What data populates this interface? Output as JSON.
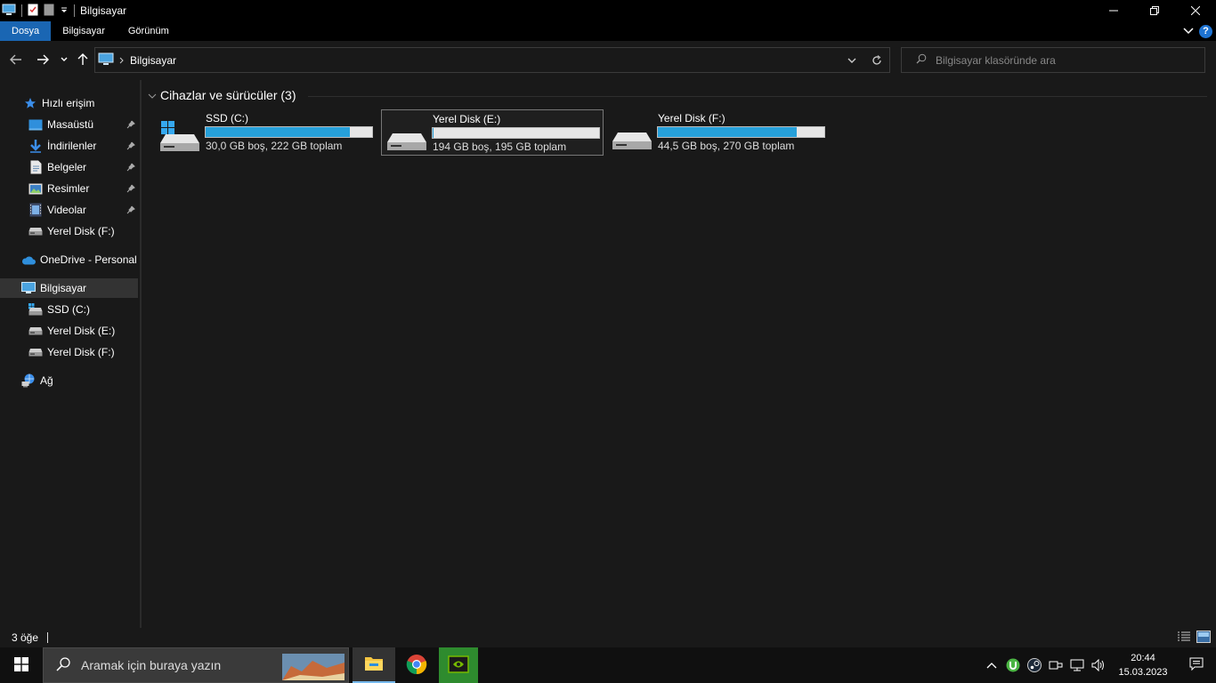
{
  "window": {
    "title": "Bilgisayar"
  },
  "ribbon": {
    "tabs": [
      "Dosya",
      "Bilgisayar",
      "Görünüm"
    ],
    "help_label": "?"
  },
  "address": {
    "crumb": "Bilgisayar"
  },
  "search": {
    "placeholder": "Bilgisayar klasöründe ara"
  },
  "nav": {
    "quick_access": "Hızlı erişim",
    "items": [
      {
        "label": "Masaüstü",
        "icon": "desktop-icon",
        "pinned": true
      },
      {
        "label": "İndirilenler",
        "icon": "download-icon",
        "pinned": true
      },
      {
        "label": "Belgeler",
        "icon": "documents-icon",
        "pinned": true
      },
      {
        "label": "Resimler",
        "icon": "pictures-icon",
        "pinned": true
      },
      {
        "label": "Videolar",
        "icon": "videos-icon",
        "pinned": true
      },
      {
        "label": "Yerel Disk (F:)",
        "icon": "drive-icon",
        "pinned": false
      }
    ],
    "onedrive": "OneDrive - Personal",
    "computer": "Bilgisayar",
    "computer_children": [
      {
        "label": "SSD  (C:)",
        "icon": "system-drive-icon"
      },
      {
        "label": "Yerel Disk (E:)",
        "icon": "drive-icon"
      },
      {
        "label": "Yerel Disk (F:)",
        "icon": "drive-icon"
      }
    ],
    "network": "Ağ"
  },
  "content": {
    "group_title": "Cihazlar ve sürücüler (3)",
    "drives": [
      {
        "name": "SSD  (C:)",
        "info": "30,0 GB boş, 222 GB toplam",
        "used_percent": 86.5,
        "system": true,
        "selected": false
      },
      {
        "name": "Yerel Disk (E:)",
        "info": "194 GB boş, 195 GB toplam",
        "used_percent": 0.5,
        "system": false,
        "selected": true
      },
      {
        "name": "Yerel Disk (F:)",
        "info": "44,5 GB boş, 270 GB toplam",
        "used_percent": 83.5,
        "system": false,
        "selected": false
      }
    ]
  },
  "status": {
    "item_count": "3 öğe"
  },
  "taskbar": {
    "search_placeholder": "Aramak için buraya yazın",
    "time": "20:44",
    "date": "15.03.2023"
  },
  "colors": {
    "accent": "#1a66b3",
    "bar_fill": "#26a0da",
    "background": "#191919"
  }
}
